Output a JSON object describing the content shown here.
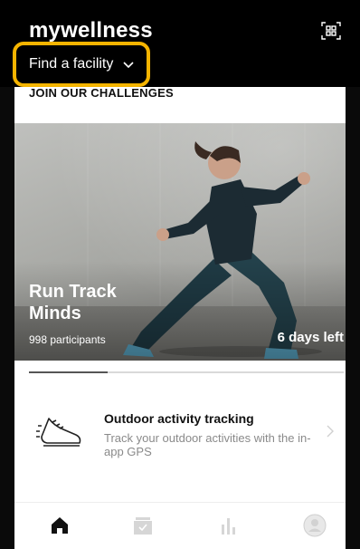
{
  "app": {
    "brand": "mywellness"
  },
  "header": {
    "facility_label": "Find a facility"
  },
  "section": {
    "title": "JOIN OUR CHALLENGES"
  },
  "challenge": {
    "title": "Run Track Minds",
    "participants": "998 participants",
    "time_left": "6 days left",
    "carousel_progress": 0.25
  },
  "activity": {
    "title": "Outdoor activity tracking",
    "description": "Track your outdoor activities with the in-app GPS"
  },
  "nav": {
    "items": [
      {
        "icon": "home-icon",
        "active": true
      },
      {
        "icon": "calendar-icon",
        "active": false
      },
      {
        "icon": "stats-icon",
        "active": false
      },
      {
        "icon": "profile-icon",
        "active": false
      }
    ]
  },
  "colors": {
    "highlight": "#f5b400",
    "header_bg": "#000000",
    "muted_icon": "#cfcfcf"
  }
}
